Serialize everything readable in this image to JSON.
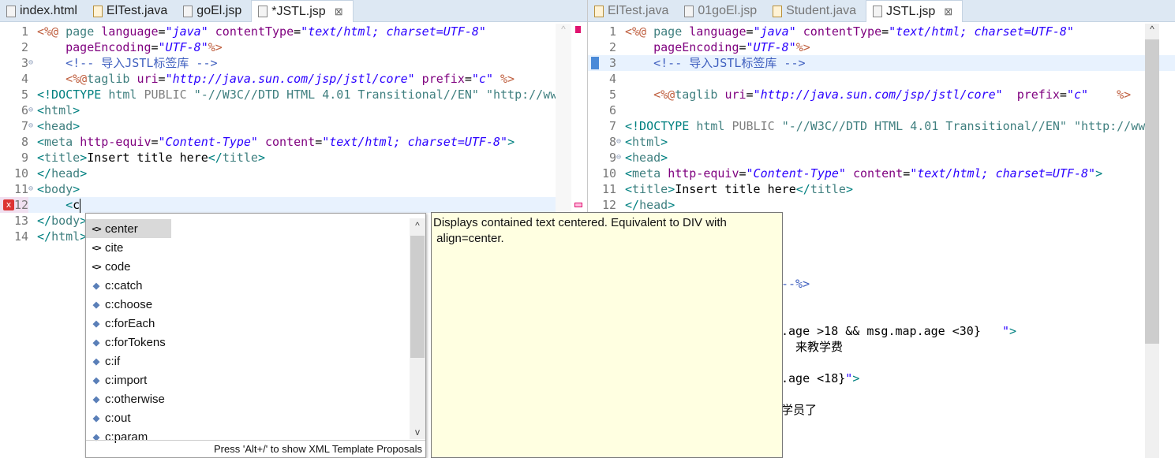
{
  "left_editor": {
    "tabs": [
      {
        "label": "index.html",
        "icon": "html-file-icon"
      },
      {
        "label": "ElTest.java",
        "icon": "java-file-icon"
      },
      {
        "label": "goEl.jsp",
        "icon": "jsp-file-icon"
      },
      {
        "label": "*JSTL.jsp",
        "icon": "jsp-file-icon",
        "active": true
      }
    ],
    "lines": [
      [
        [
          "j",
          "<%@ "
        ],
        [
          "t",
          "page "
        ],
        [
          "a",
          "language"
        ],
        [
          "k",
          "="
        ],
        [
          "v",
          "\"java\""
        ],
        [
          "k",
          " "
        ],
        [
          "a",
          "contentType"
        ],
        [
          "k",
          "="
        ],
        [
          "v",
          "\"text/html; charset=UTF-8\""
        ]
      ],
      [
        [
          "k",
          "    "
        ],
        [
          "a",
          "pageEncoding"
        ],
        [
          "k",
          "="
        ],
        [
          "v",
          "\"UTF-8\""
        ],
        [
          "j",
          "%>"
        ]
      ],
      [
        [
          "k",
          "    "
        ],
        [
          "c",
          "<!-- 导入JSTL标签库 -->"
        ]
      ],
      [
        [
          "k",
          "    "
        ],
        [
          "j",
          "<%@"
        ],
        [
          "t",
          "taglib "
        ],
        [
          "a",
          "uri"
        ],
        [
          "k",
          "="
        ],
        [
          "v",
          "\"http://java.sun.com/jsp/jstl/core\""
        ],
        [
          "k",
          " "
        ],
        [
          "a",
          "prefix"
        ],
        [
          "k",
          "="
        ],
        [
          "v",
          "\"c\""
        ],
        [
          "k",
          " "
        ],
        [
          "j",
          "%>"
        ]
      ],
      [
        [
          "b",
          "<!DOCTYPE "
        ],
        [
          "t",
          "html "
        ],
        [
          "g",
          "PUBLIC "
        ],
        [
          "s",
          "\"-//W3C//DTD HTML 4.01 Transitional//EN\" \"http://ww"
        ]
      ],
      [
        [
          "b",
          "<"
        ],
        [
          "t",
          "html"
        ],
        [
          "b",
          ">"
        ]
      ],
      [
        [
          "b",
          "<"
        ],
        [
          "t",
          "head"
        ],
        [
          "b",
          ">"
        ]
      ],
      [
        [
          "b",
          "<"
        ],
        [
          "t",
          "meta "
        ],
        [
          "a",
          "http-equiv"
        ],
        [
          "k",
          "="
        ],
        [
          "v",
          "\"Content-Type\""
        ],
        [
          "k",
          " "
        ],
        [
          "a",
          "content"
        ],
        [
          "k",
          "="
        ],
        [
          "v",
          "\"text/html; charset=UTF-8\""
        ],
        [
          "b",
          ">"
        ]
      ],
      [
        [
          "b",
          "<"
        ],
        [
          "t",
          "title"
        ],
        [
          "b",
          ">"
        ],
        [
          "k",
          "Insert title here"
        ],
        [
          "b",
          "</"
        ],
        [
          "t",
          "title"
        ],
        [
          "b",
          ">"
        ]
      ],
      [
        [
          "b",
          "</"
        ],
        [
          "t",
          "head"
        ],
        [
          "b",
          ">"
        ]
      ],
      [
        [
          "b",
          "<"
        ],
        [
          "t",
          "body"
        ],
        [
          "b",
          ">"
        ]
      ],
      [
        [
          "k",
          "    "
        ],
        [
          "b",
          "<"
        ],
        [
          "k",
          "c"
        ]
      ],
      [
        [
          "b",
          "</"
        ],
        [
          "t",
          "body"
        ],
        [
          "b",
          ">"
        ]
      ],
      [
        [
          "b",
          "</"
        ],
        [
          "t",
          "html"
        ],
        [
          "b",
          ">"
        ]
      ]
    ],
    "fold_lines": [
      3,
      6,
      7,
      11
    ],
    "error_line": 12,
    "current_line": 12
  },
  "right_editor": {
    "tabs": [
      {
        "label": "ElTest.java",
        "icon": "java-file-icon"
      },
      {
        "label": "01goEl.jsp",
        "icon": "jsp-file-icon"
      },
      {
        "label": "Student.java",
        "icon": "java-file-icon"
      },
      {
        "label": "JSTL.jsp",
        "icon": "jsp-file-icon",
        "active": true
      }
    ],
    "lines": [
      [
        [
          "j",
          "<%@ "
        ],
        [
          "t",
          "page "
        ],
        [
          "a",
          "language"
        ],
        [
          "k",
          "="
        ],
        [
          "v",
          "\"java\""
        ],
        [
          "k",
          " "
        ],
        [
          "a",
          "contentType"
        ],
        [
          "k",
          "="
        ],
        [
          "v",
          "\"text/html; charset=UTF-8\""
        ]
      ],
      [
        [
          "k",
          "    "
        ],
        [
          "a",
          "pageEncoding"
        ],
        [
          "k",
          "="
        ],
        [
          "v",
          "\"UTF-8\""
        ],
        [
          "j",
          "%>"
        ]
      ],
      [
        [
          "k",
          "    "
        ],
        [
          "c",
          "<!-- 导入JSTL标签库 -->"
        ]
      ],
      [],
      [
        [
          "k",
          "    "
        ],
        [
          "j",
          "<%@"
        ],
        [
          "t",
          "taglib "
        ],
        [
          "a",
          "uri"
        ],
        [
          "k",
          "="
        ],
        [
          "v",
          "\"http://java.sun.com/jsp/jstl/core\""
        ],
        [
          "k",
          "  "
        ],
        [
          "a",
          "prefix"
        ],
        [
          "k",
          "="
        ],
        [
          "v",
          "\"c\""
        ],
        [
          "k",
          "    "
        ],
        [
          "j",
          "%>"
        ]
      ],
      [],
      [
        [
          "b",
          "<!DOCTYPE "
        ],
        [
          "t",
          "html "
        ],
        [
          "g",
          "PUBLIC "
        ],
        [
          "s",
          "\"-//W3C//DTD HTML 4.01 Transitional//EN\" \"http://ww"
        ]
      ],
      [
        [
          "b",
          "<"
        ],
        [
          "t",
          "html"
        ],
        [
          "b",
          ">"
        ]
      ],
      [
        [
          "b",
          "<"
        ],
        [
          "t",
          "head"
        ],
        [
          "b",
          ">"
        ]
      ],
      [
        [
          "b",
          "<"
        ],
        [
          "t",
          "meta "
        ],
        [
          "a",
          "http-equiv"
        ],
        [
          "k",
          "="
        ],
        [
          "v",
          "\"Content-Type\""
        ],
        [
          "k",
          " "
        ],
        [
          "a",
          "content"
        ],
        [
          "k",
          "="
        ],
        [
          "v",
          "\"text/html; charset=UTF-8\""
        ],
        [
          "b",
          ">"
        ]
      ],
      [
        [
          "b",
          "<"
        ],
        [
          "t",
          "title"
        ],
        [
          "b",
          ">"
        ],
        [
          "k",
          "Insert title here"
        ],
        [
          "b",
          "</"
        ],
        [
          "t",
          "title"
        ],
        [
          "b",
          ">"
        ]
      ],
      [
        [
          "b",
          "</"
        ],
        [
          "t",
          "head"
        ],
        [
          "b",
          ">"
        ]
      ]
    ],
    "fold_lines": [
      8,
      9
    ],
    "current_line": 3,
    "partial_lines": [
      {
        "line": 17,
        "tokens": [
          [
            "c",
            "--%>"
          ]
        ]
      },
      {
        "line": 20,
        "tokens": [
          [
            "k",
            ".age >18 && msg.map.age <30}   "
          ],
          [
            "v",
            "\""
          ],
          [
            "b",
            ">"
          ]
        ]
      },
      {
        "line": 21,
        "tokens": [
          [
            "k",
            "  来教学费"
          ]
        ]
      },
      {
        "line": 23,
        "tokens": [
          [
            "k",
            ".age <18}"
          ],
          [
            "v",
            "\""
          ],
          [
            "b",
            ">"
          ]
        ]
      },
      {
        "line": 25,
        "tokens": [
          [
            "k",
            "学员了"
          ]
        ]
      }
    ]
  },
  "completion": {
    "items": [
      {
        "label": "center",
        "icon": "html-tag-icon",
        "selected": true
      },
      {
        "label": "cite",
        "icon": "html-tag-icon"
      },
      {
        "label": "code",
        "icon": "html-tag-icon"
      },
      {
        "label": "c:catch",
        "icon": "jstl-tag-icon"
      },
      {
        "label": "c:choose",
        "icon": "jstl-tag-icon"
      },
      {
        "label": "c:forEach",
        "icon": "jstl-tag-icon"
      },
      {
        "label": "c:forTokens",
        "icon": "jstl-tag-icon"
      },
      {
        "label": "c:if",
        "icon": "jstl-tag-icon"
      },
      {
        "label": "c:import",
        "icon": "jstl-tag-icon"
      },
      {
        "label": "c:otherwise",
        "icon": "jstl-tag-icon"
      },
      {
        "label": "c:out",
        "icon": "jstl-tag-icon"
      },
      {
        "label": "c:param",
        "icon": "jstl-tag-icon"
      }
    ],
    "footer": "Press 'Alt+/' to show XML Template Proposals",
    "doc": "Displays contained text centered. Equivalent to DIV with\n align=center."
  },
  "colors": {
    "tag_bracket": "#008080",
    "tag_name": "#3f7f7f",
    "attr_name": "#7f007f",
    "attr_value": "#2a00ff",
    "jsp_delim": "#bf5f3f",
    "comment": "#3f5fbf",
    "tooltip_bg": "#ffffe1"
  }
}
